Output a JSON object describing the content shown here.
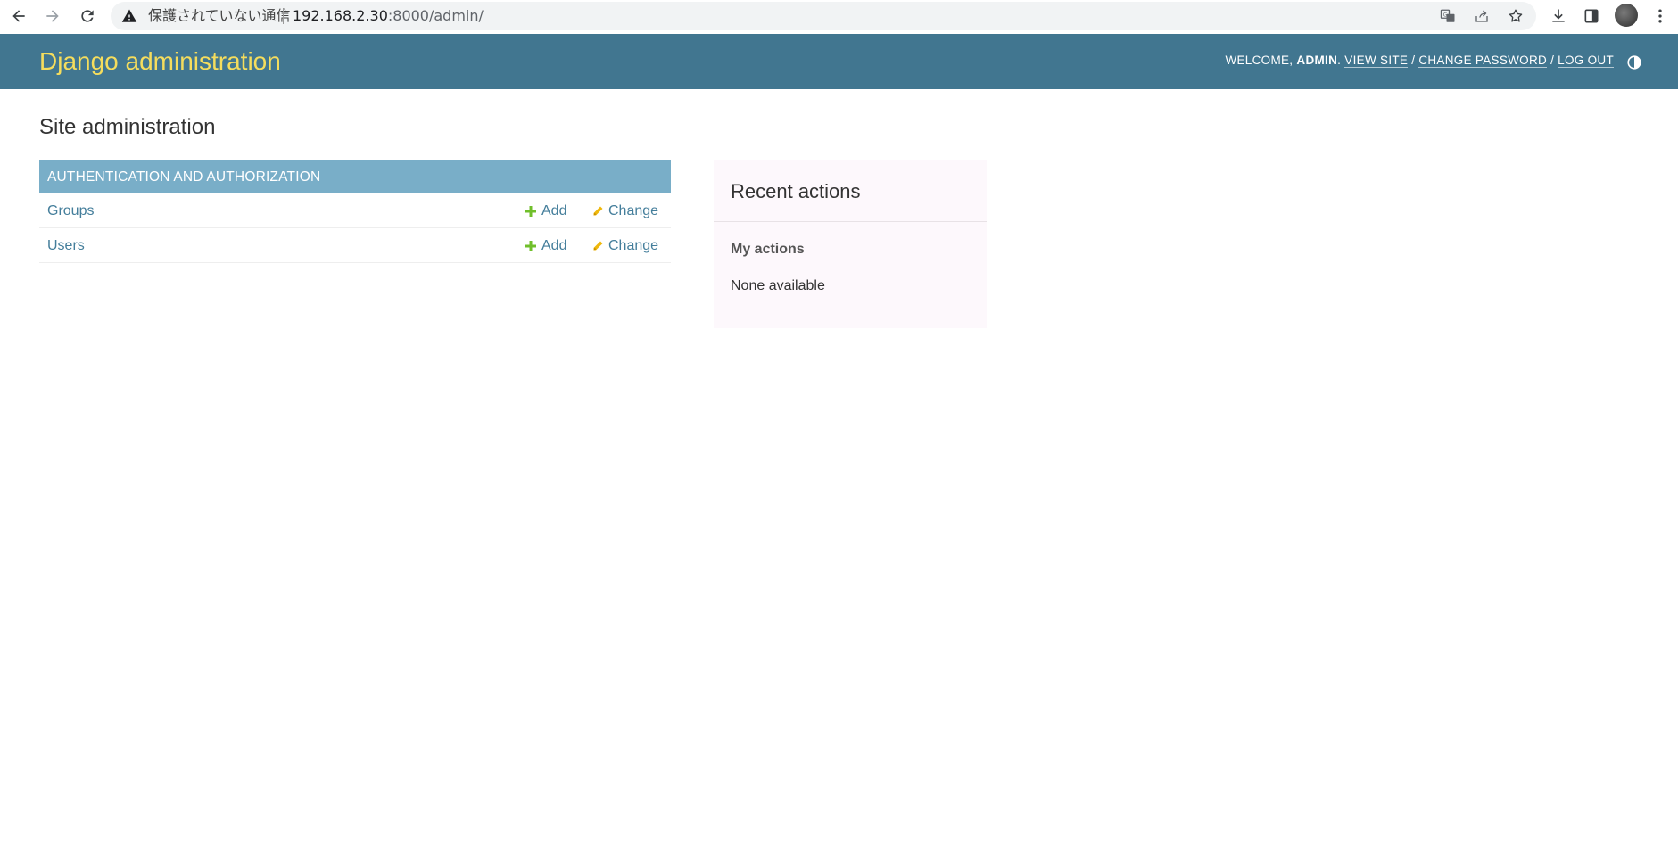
{
  "browser": {
    "security_label": "保護されていない通信",
    "url_host": "192.168.2.30",
    "url_path": ":8000/admin/"
  },
  "header": {
    "branding": "Django administration",
    "welcome": "Welcome,",
    "username": "admin",
    "username_suffix": ".",
    "view_site": "View site",
    "change_password": "Change password",
    "log_out": "Log out",
    "separator": "/"
  },
  "content": {
    "title": "Site administration"
  },
  "app_module": {
    "caption": "Authentication and Authorization",
    "models": [
      {
        "name": "Groups",
        "add_label": "Add",
        "change_label": "Change"
      },
      {
        "name": "Users",
        "add_label": "Add",
        "change_label": "Change"
      }
    ]
  },
  "recent_actions": {
    "title": "Recent actions",
    "subtitle": "My actions",
    "empty": "None available"
  },
  "colors": {
    "header_bg": "#417690",
    "branding": "#f5dd5d",
    "module_caption_bg": "#79aec8",
    "link": "#447e9b",
    "add_icon": "#70bf2b",
    "change_icon": "#efb80b"
  }
}
